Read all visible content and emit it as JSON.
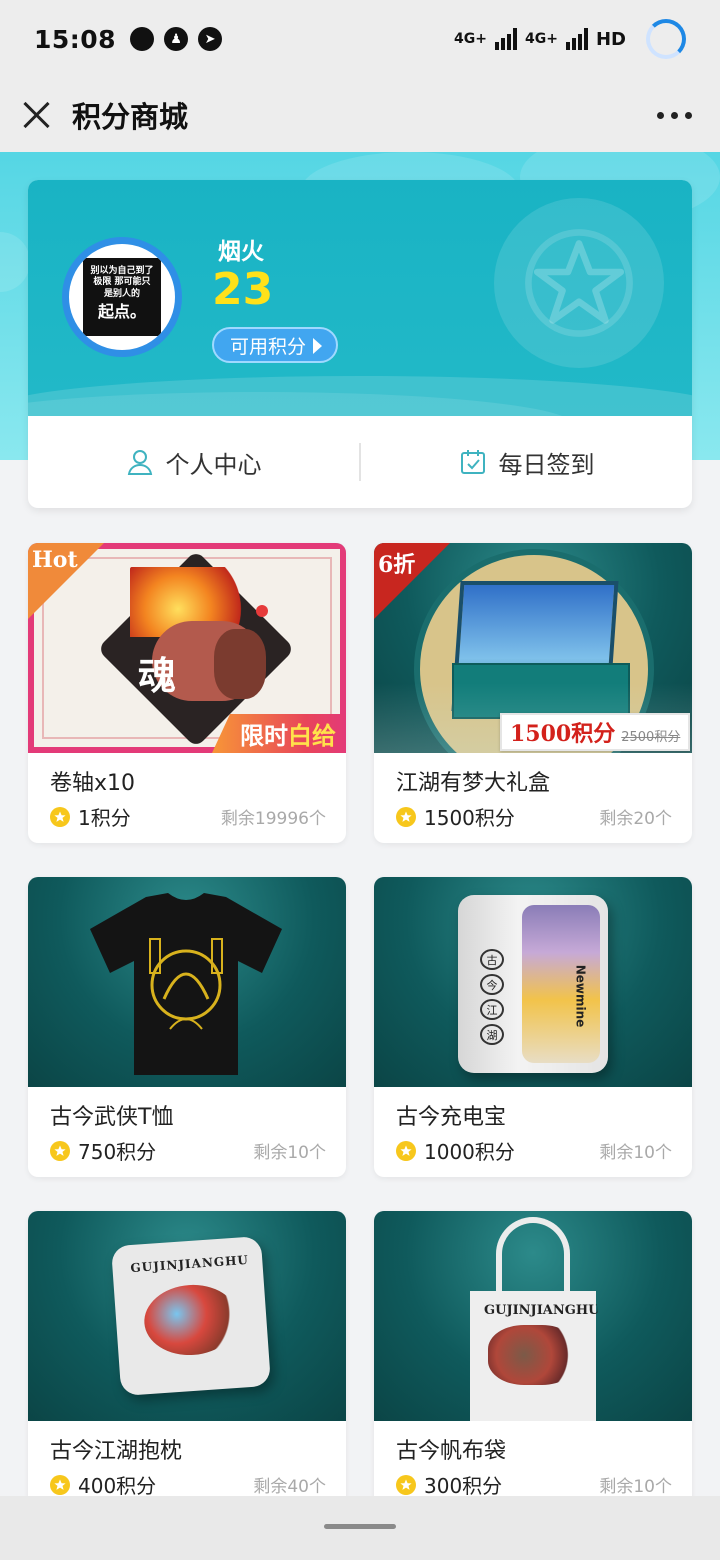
{
  "status_bar": {
    "time": "15:08",
    "network_1": "4G+",
    "network_2": "4G+",
    "hd": "HD"
  },
  "title_bar": {
    "title": "积分商城"
  },
  "profile": {
    "username": "烟火",
    "points": "23",
    "points_label": "可用积分",
    "avatar_text_small": "别以为自己到了极限 那可能只是别人的",
    "avatar_text_big": "起点。"
  },
  "profile_links": {
    "personal_center": "个人中心",
    "daily_checkin": "每日签到"
  },
  "products": [
    {
      "name": "卷轴x10",
      "price": "1积分",
      "stock": "剩余19996个",
      "ribbon": "Hot",
      "promo_prefix": "限时",
      "promo_highlight": "白给"
    },
    {
      "name": "江湖有梦大礼盒",
      "price": "1500积分",
      "stock": "剩余20个",
      "ribbon": "6折",
      "tag_now": "1500积分",
      "tag_was": "2500积分"
    },
    {
      "name": "古今武侠T恤",
      "price": "750积分",
      "stock": "剩余10个"
    },
    {
      "name": "古今充电宝",
      "price": "1000积分",
      "stock": "剩余10个",
      "seal": [
        "古",
        "今",
        "江",
        "湖"
      ],
      "brand": "Newmine"
    },
    {
      "name": "古今江湖抱枕",
      "price": "400积分",
      "stock": "剩余40个",
      "art_text": "GUJINJIANGHU"
    },
    {
      "name": "古今帆布袋",
      "price": "300积分",
      "stock": "剩余10个",
      "art_text": "GUJINJIANGHU"
    }
  ],
  "colors": {
    "banner": "#19b3c4",
    "points": "#ffe11a",
    "button": "#41a6f0",
    "coin": "#f7c71c",
    "ribbon_hot": "#f08a3a",
    "ribbon_sale": "#c8261f"
  }
}
